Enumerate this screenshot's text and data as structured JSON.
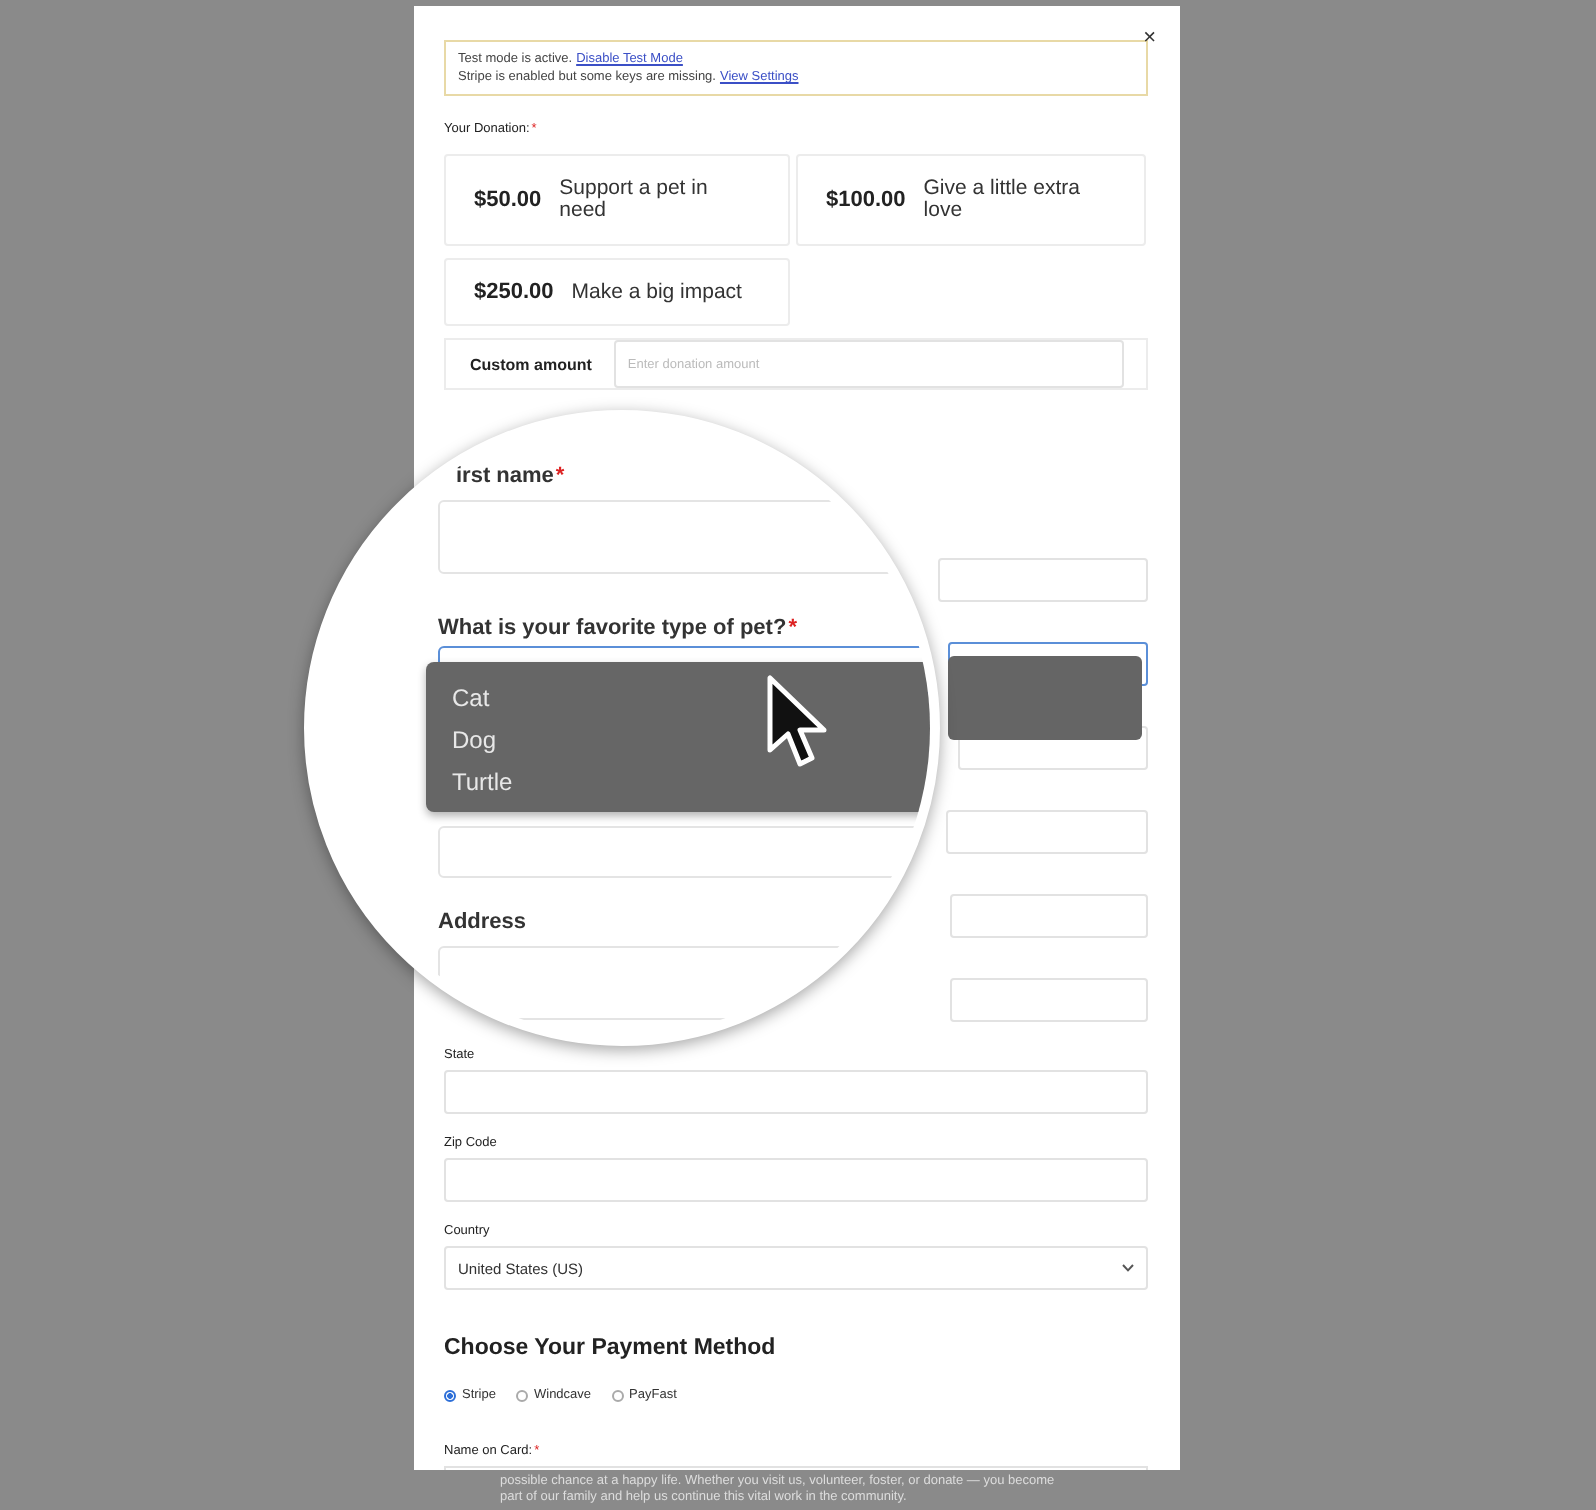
{
  "close": "×",
  "notice": [
    {
      "text": "Test mode is active.",
      "link": "Disable Test Mode"
    },
    {
      "text": "Stripe is enabled but some keys are missing.",
      "link": "View Settings"
    }
  ],
  "donation": {
    "label": "Your Donation:",
    "mark": "*",
    "options": [
      {
        "amount": "$50.00",
        "description": "Support a pet in need"
      },
      {
        "amount": "$100.00",
        "description": "Give a little extra love"
      },
      {
        "amount": "$250.00",
        "description": "Make a big impact"
      }
    ],
    "custom": {
      "label": "Custom amount",
      "placeholder": "Enter donation amount"
    }
  },
  "fields": [
    {
      "kind": "text"
    },
    {
      "kind": "select",
      "focused": true,
      "expanded": true
    },
    {
      "kind": "text"
    },
    {
      "kind": "text"
    },
    {
      "kind": "text"
    },
    {
      "kind": "text"
    },
    {
      "kind": "text",
      "label": "State"
    },
    {
      "kind": "text",
      "label": "Zip Code"
    },
    {
      "kind": "select",
      "label": "Country",
      "value": "United States (US)",
      "focused": false
    }
  ],
  "payment": {
    "heading": "Choose Your Payment Method",
    "methods": [
      {
        "label": "Stripe",
        "selected": true
      },
      {
        "label": "Windcave",
        "selected": false
      },
      {
        "label": "PayFast",
        "selected": false
      }
    ],
    "card_label": "Name on Card:",
    "mark": "*"
  },
  "magnifier": {
    "fields": [
      {
        "kind": "text",
        "label": "irst name",
        "mark": "*"
      },
      {
        "kind": "select",
        "label": "What is your favorite type of pet?",
        "mark": "*",
        "expanded": true,
        "options": [
          "Cat",
          "Dog",
          "Turtle"
        ]
      },
      {
        "kind": "text"
      },
      {
        "kind": "text",
        "label": "Address"
      }
    ]
  },
  "footer_text": [
    "possible chance at a happy life. Whether you visit us, volunteer, foster, or donate — you become",
    "part of our family and help us continue this vital work in the community."
  ]
}
